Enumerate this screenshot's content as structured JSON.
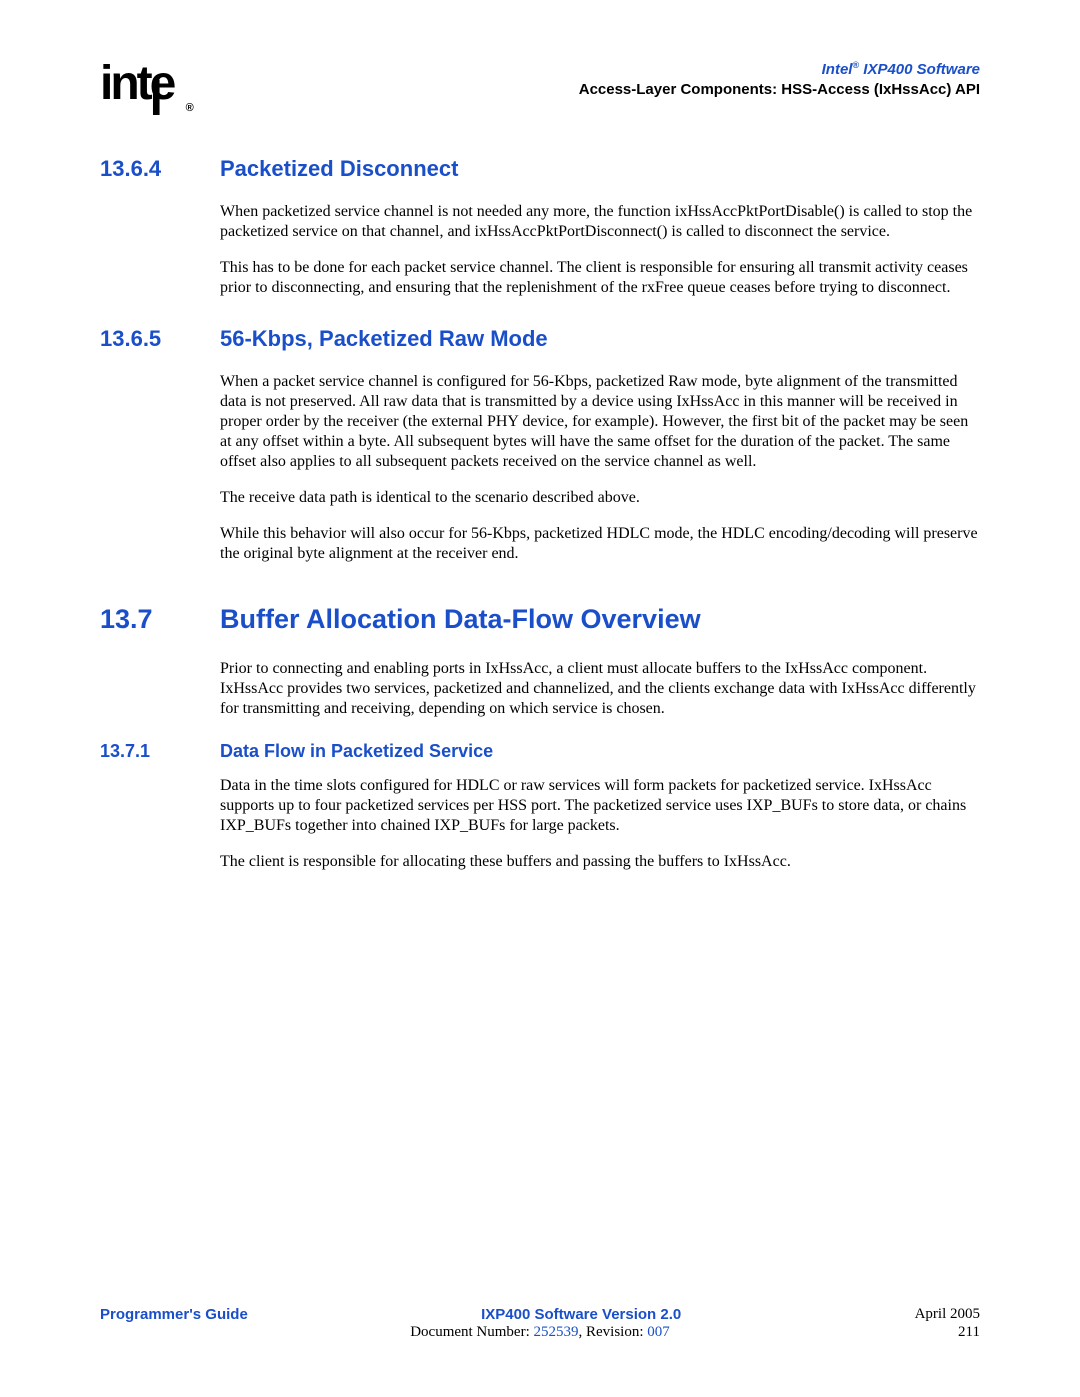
{
  "header": {
    "product_pre": "Intel",
    "product_post": " IXP400 Software",
    "section": "Access-Layer Components: HSS-Access (IxHssAcc) API"
  },
  "sections": {
    "s1": {
      "num": "13.6.4",
      "title": "Packetized Disconnect"
    },
    "s2": {
      "num": "13.6.5",
      "title": "56-Kbps, Packetized Raw Mode"
    },
    "s3": {
      "num": "13.7",
      "title": "Buffer Allocation Data-Flow Overview"
    },
    "s4": {
      "num": "13.7.1",
      "title": "Data Flow in Packetized Service"
    }
  },
  "paras": {
    "p1": "When packetized service channel is not needed any more, the function ixHssAccPktPortDisable() is called to stop the packetized service on that channel, and ixHssAccPktPortDisconnect() is called to disconnect the service.",
    "p2": "This has to be done for each packet service channel. The client is responsible for ensuring all transmit activity ceases prior to disconnecting, and ensuring that the replenishment of the rxFree queue ceases before trying to disconnect.",
    "p3": "When a packet service channel is configured for 56-Kbps, packetized Raw mode, byte alignment of the transmitted data is not preserved. All raw data that is transmitted by a device using IxHssAcc in this manner will be received in proper order by the receiver (the external PHY device, for example). However, the first bit of the packet may be seen at any offset within a byte. All subsequent bytes will have the same offset for the duration of the packet. The same offset also applies to all subsequent packets received on the service channel as well.",
    "p4": "The receive data path is identical to the scenario described above.",
    "p5": "While this behavior will also occur for 56-Kbps, packetized HDLC mode, the HDLC encoding/decoding will preserve the original byte alignment at the receiver end.",
    "p6": "Prior to connecting and enabling ports in IxHssAcc, a client must allocate buffers to the IxHssAcc component. IxHssAcc provides two services, packetized and channelized, and the clients exchange data with IxHssAcc differently for transmitting and receiving, depending on which service is chosen.",
    "p7": "Data in the time slots configured for HDLC or raw services will form packets for packetized service. IxHssAcc supports up to four packetized services per HSS port. The packetized service uses IXP_BUFs to store data, or chains IXP_BUFs together into chained IXP_BUFs for large packets.",
    "p8": "The client is responsible for allocating these buffers and passing the buffers to IxHssAcc."
  },
  "footer": {
    "left": "Programmer's Guide",
    "center": "IXP400 Software Version 2.0",
    "date": "April 2005",
    "doc_label_pre": "Document Number: ",
    "doc_number": "252539",
    "doc_label_mid": ", Revision: ",
    "revision": "007",
    "page": "211"
  }
}
